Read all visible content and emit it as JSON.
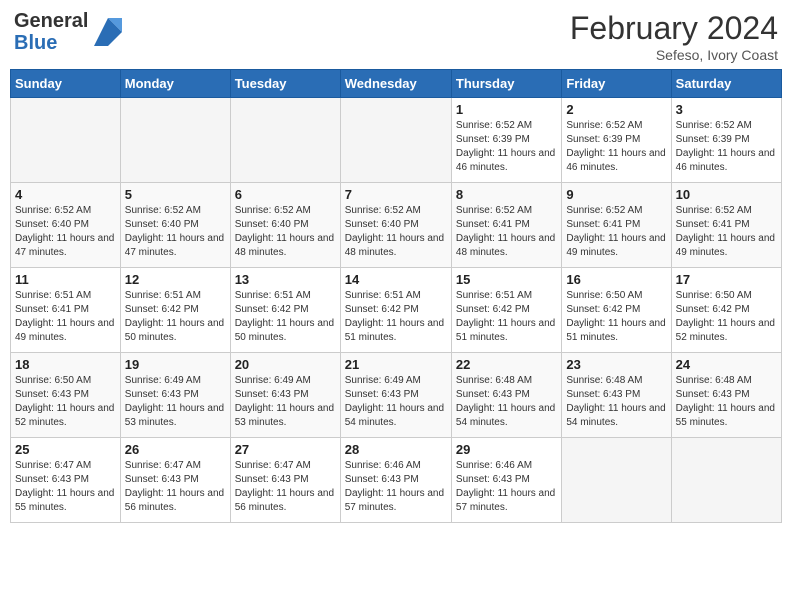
{
  "header": {
    "logo_general": "General",
    "logo_blue": "Blue",
    "title": "February 2024",
    "subtitle": "Sefeso, Ivory Coast"
  },
  "days_of_week": [
    "Sunday",
    "Monday",
    "Tuesday",
    "Wednesday",
    "Thursday",
    "Friday",
    "Saturday"
  ],
  "weeks": [
    [
      {
        "day": "",
        "info": ""
      },
      {
        "day": "",
        "info": ""
      },
      {
        "day": "",
        "info": ""
      },
      {
        "day": "",
        "info": ""
      },
      {
        "day": "1",
        "info": "Sunrise: 6:52 AM\nSunset: 6:39 PM\nDaylight: 11 hours and 46 minutes."
      },
      {
        "day": "2",
        "info": "Sunrise: 6:52 AM\nSunset: 6:39 PM\nDaylight: 11 hours and 46 minutes."
      },
      {
        "day": "3",
        "info": "Sunrise: 6:52 AM\nSunset: 6:39 PM\nDaylight: 11 hours and 46 minutes."
      }
    ],
    [
      {
        "day": "4",
        "info": "Sunrise: 6:52 AM\nSunset: 6:40 PM\nDaylight: 11 hours and 47 minutes."
      },
      {
        "day": "5",
        "info": "Sunrise: 6:52 AM\nSunset: 6:40 PM\nDaylight: 11 hours and 47 minutes."
      },
      {
        "day": "6",
        "info": "Sunrise: 6:52 AM\nSunset: 6:40 PM\nDaylight: 11 hours and 48 minutes."
      },
      {
        "day": "7",
        "info": "Sunrise: 6:52 AM\nSunset: 6:40 PM\nDaylight: 11 hours and 48 minutes."
      },
      {
        "day": "8",
        "info": "Sunrise: 6:52 AM\nSunset: 6:41 PM\nDaylight: 11 hours and 48 minutes."
      },
      {
        "day": "9",
        "info": "Sunrise: 6:52 AM\nSunset: 6:41 PM\nDaylight: 11 hours and 49 minutes."
      },
      {
        "day": "10",
        "info": "Sunrise: 6:52 AM\nSunset: 6:41 PM\nDaylight: 11 hours and 49 minutes."
      }
    ],
    [
      {
        "day": "11",
        "info": "Sunrise: 6:51 AM\nSunset: 6:41 PM\nDaylight: 11 hours and 49 minutes."
      },
      {
        "day": "12",
        "info": "Sunrise: 6:51 AM\nSunset: 6:42 PM\nDaylight: 11 hours and 50 minutes."
      },
      {
        "day": "13",
        "info": "Sunrise: 6:51 AM\nSunset: 6:42 PM\nDaylight: 11 hours and 50 minutes."
      },
      {
        "day": "14",
        "info": "Sunrise: 6:51 AM\nSunset: 6:42 PM\nDaylight: 11 hours and 51 minutes."
      },
      {
        "day": "15",
        "info": "Sunrise: 6:51 AM\nSunset: 6:42 PM\nDaylight: 11 hours and 51 minutes."
      },
      {
        "day": "16",
        "info": "Sunrise: 6:50 AM\nSunset: 6:42 PM\nDaylight: 11 hours and 51 minutes."
      },
      {
        "day": "17",
        "info": "Sunrise: 6:50 AM\nSunset: 6:42 PM\nDaylight: 11 hours and 52 minutes."
      }
    ],
    [
      {
        "day": "18",
        "info": "Sunrise: 6:50 AM\nSunset: 6:43 PM\nDaylight: 11 hours and 52 minutes."
      },
      {
        "day": "19",
        "info": "Sunrise: 6:49 AM\nSunset: 6:43 PM\nDaylight: 11 hours and 53 minutes."
      },
      {
        "day": "20",
        "info": "Sunrise: 6:49 AM\nSunset: 6:43 PM\nDaylight: 11 hours and 53 minutes."
      },
      {
        "day": "21",
        "info": "Sunrise: 6:49 AM\nSunset: 6:43 PM\nDaylight: 11 hours and 54 minutes."
      },
      {
        "day": "22",
        "info": "Sunrise: 6:48 AM\nSunset: 6:43 PM\nDaylight: 11 hours and 54 minutes."
      },
      {
        "day": "23",
        "info": "Sunrise: 6:48 AM\nSunset: 6:43 PM\nDaylight: 11 hours and 54 minutes."
      },
      {
        "day": "24",
        "info": "Sunrise: 6:48 AM\nSunset: 6:43 PM\nDaylight: 11 hours and 55 minutes."
      }
    ],
    [
      {
        "day": "25",
        "info": "Sunrise: 6:47 AM\nSunset: 6:43 PM\nDaylight: 11 hours and 55 minutes."
      },
      {
        "day": "26",
        "info": "Sunrise: 6:47 AM\nSunset: 6:43 PM\nDaylight: 11 hours and 56 minutes."
      },
      {
        "day": "27",
        "info": "Sunrise: 6:47 AM\nSunset: 6:43 PM\nDaylight: 11 hours and 56 minutes."
      },
      {
        "day": "28",
        "info": "Sunrise: 6:46 AM\nSunset: 6:43 PM\nDaylight: 11 hours and 57 minutes."
      },
      {
        "day": "29",
        "info": "Sunrise: 6:46 AM\nSunset: 6:43 PM\nDaylight: 11 hours and 57 minutes."
      },
      {
        "day": "",
        "info": ""
      },
      {
        "day": "",
        "info": ""
      }
    ]
  ]
}
